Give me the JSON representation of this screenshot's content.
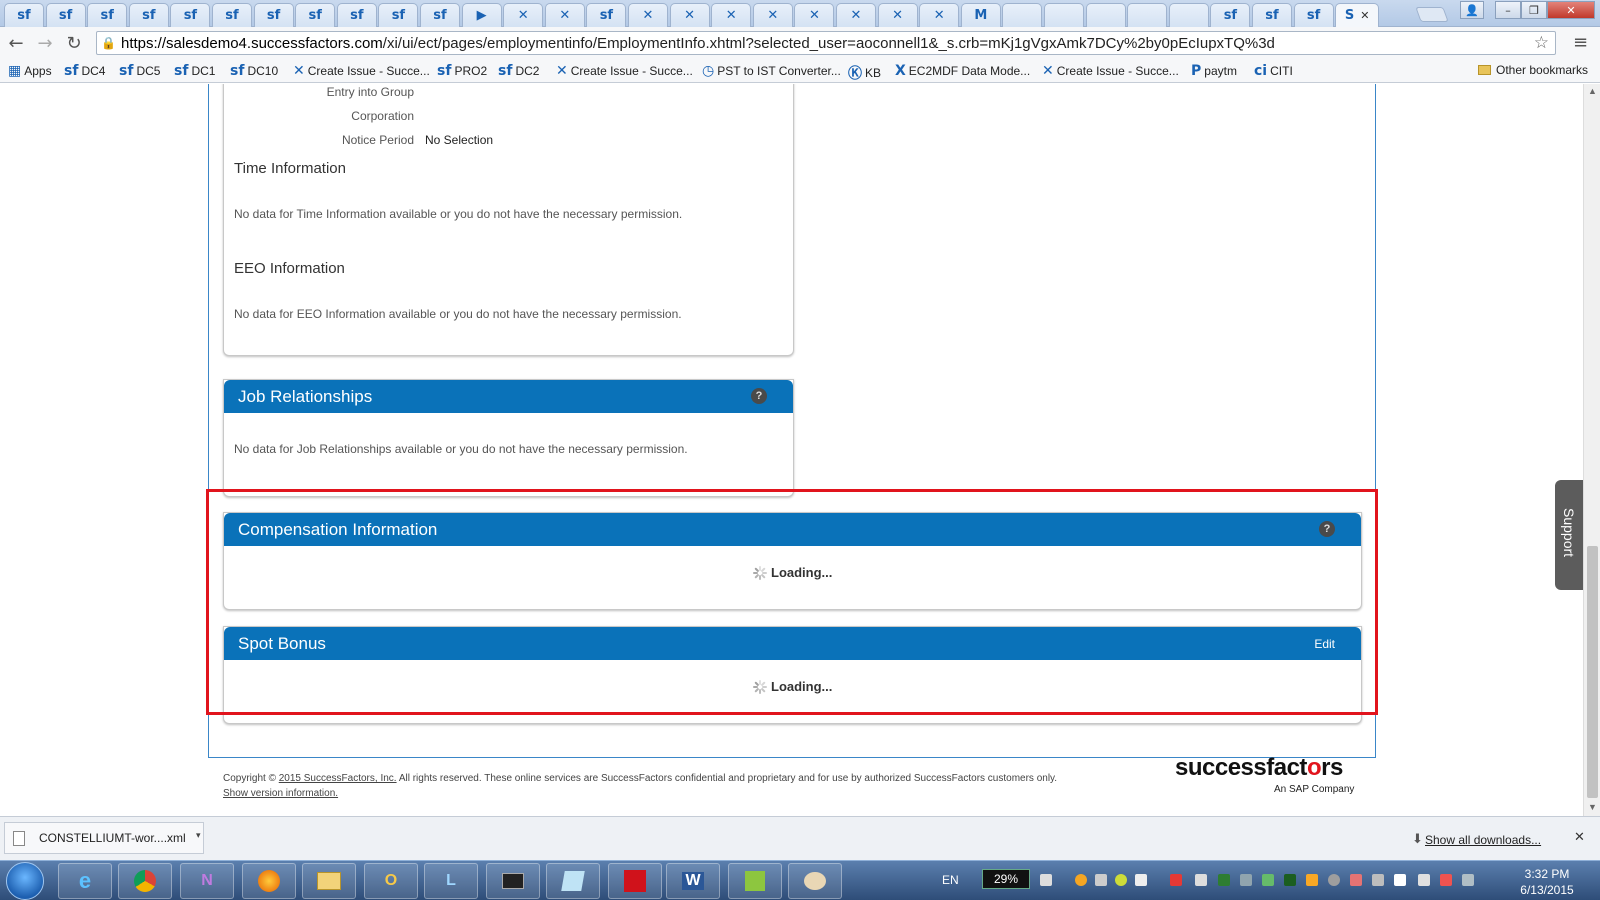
{
  "browser": {
    "tabs": [
      "sf",
      "sf",
      "sf",
      "sf",
      "sf",
      "sf",
      "sf",
      "sf",
      "sf",
      "sf",
      "sf",
      "▶",
      "✕",
      "✕",
      "sf",
      "✕",
      "✕",
      "✕",
      "✕",
      "✕",
      "✕",
      "✕",
      "✕",
      "M",
      "",
      "",
      "",
      "",
      "",
      "sf",
      "sf",
      "sf",
      "S"
    ],
    "active_tab_label": "S",
    "url_host": "https://salesdemo4.successfactors.com",
    "url_path": "/xi/ui/ect/pages/employmentinfo/EmploymentInfo.xhtml?selected_user=aoconnell1&_s.crb=mKj1gVgxAmk7DCy%2by0pEcIupxTQ%3d",
    "bookmarks": [
      {
        "icon": "apps-grid-icon",
        "label": "Apps"
      },
      {
        "icon": "sf-icon",
        "label": "DC4"
      },
      {
        "icon": "sf-icon",
        "label": "DC5"
      },
      {
        "icon": "sf-icon",
        "label": "DC1"
      },
      {
        "icon": "sf-icon",
        "label": "DC10"
      },
      {
        "icon": "jira-icon",
        "label": "Create Issue - Succe..."
      },
      {
        "icon": "sf-icon",
        "label": "PRO2"
      },
      {
        "icon": "sf-icon",
        "label": "DC2"
      },
      {
        "icon": "jira-icon",
        "label": "Create Issue - Succe..."
      },
      {
        "icon": "clock-icon",
        "label": "PST to IST Converter..."
      },
      {
        "icon": "kb-icon",
        "label": "KB"
      },
      {
        "icon": "x-icon",
        "label": "EC2MDF Data Mode..."
      },
      {
        "icon": "jira-icon",
        "label": "Create Issue - Succe..."
      },
      {
        "icon": "paytm-icon",
        "label": "paytm"
      },
      {
        "icon": "citi-icon",
        "label": "CITI"
      }
    ],
    "other_bookmarks": "Other bookmarks"
  },
  "job_info": {
    "fields": [
      {
        "label": "Entry into Group",
        "value": ""
      },
      {
        "label": "Corporation",
        "value": ""
      },
      {
        "label": "Notice Period",
        "value": "No Selection"
      }
    ],
    "time_title": "Time Information",
    "time_nodata": "No data for Time Information available or you do not have the necessary permission.",
    "eeo_title": "EEO Information",
    "eeo_nodata": "No data for EEO Information available or you do not have the necessary permission."
  },
  "job_relationships": {
    "title": "Job Relationships",
    "nodata": "No data for Job Relationships available or you do not have the necessary permission."
  },
  "compensation": {
    "title": "Compensation Information",
    "loading": "Loading..."
  },
  "spot_bonus": {
    "title": "Spot Bonus",
    "edit": "Edit",
    "loading": "Loading..."
  },
  "support": "Support",
  "footer": {
    "copyright_prefix": "Copyright ©",
    "copyright_link": "2015 SuccessFactors, Inc.",
    "copyright_suffix": "All rights reserved. These online services are SuccessFactors confidential and proprietary and for use by authorized SuccessFactors customers only.",
    "version_link": "Show version information.",
    "logo_pre": "successfact",
    "logo_heart": "o",
    "logo_post": "rs",
    "logo_sub": "An SAP Company"
  },
  "downloads": {
    "file": "CONSTELLIUMT-wor....xml",
    "show_all": "Show all downloads..."
  },
  "taskbar": {
    "lang": "EN",
    "battery": "29%",
    "time": "3:32 PM",
    "date": "6/13/2015"
  },
  "colors": {
    "header_blue": "#0a72b9",
    "highlight_red": "#e1141d"
  }
}
